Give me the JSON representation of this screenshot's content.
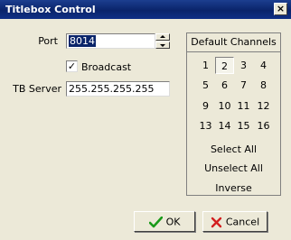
{
  "window": {
    "title": "Titlebox Control",
    "close_glyph": "×"
  },
  "form": {
    "port_label": "Port",
    "port_value": "8014",
    "broadcast_label": "Broadcast",
    "broadcast_checked": true,
    "tb_server_label": "TB Server",
    "tb_server_value": "255.255.255.255"
  },
  "channels": {
    "header": "Default Channels",
    "rows": [
      [
        "1",
        "2",
        "3",
        "4"
      ],
      [
        "5",
        "6",
        "7",
        "8"
      ],
      [
        "9",
        "10",
        "11",
        "12"
      ],
      [
        "13",
        "14",
        "15",
        "16"
      ]
    ],
    "selected": "2",
    "select_all": "Select All",
    "unselect_all": "Unselect All",
    "inverse": "Inverse"
  },
  "buttons": {
    "ok_label": "OK",
    "cancel_label": "Cancel",
    "ok_icon": "checkmark-icon",
    "cancel_icon": "x-icon",
    "ok_color": "#1a9a1a",
    "cancel_color": "#d21f1f"
  }
}
